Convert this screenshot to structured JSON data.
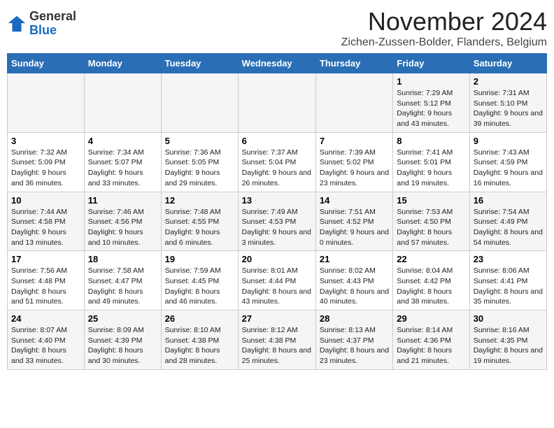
{
  "logo": {
    "general": "General",
    "blue": "Blue"
  },
  "title": "November 2024",
  "location": "Zichen-Zussen-Bolder, Flanders, Belgium",
  "weekdays": [
    "Sunday",
    "Monday",
    "Tuesday",
    "Wednesday",
    "Thursday",
    "Friday",
    "Saturday"
  ],
  "weeks": [
    [
      {
        "day": "",
        "info": ""
      },
      {
        "day": "",
        "info": ""
      },
      {
        "day": "",
        "info": ""
      },
      {
        "day": "",
        "info": ""
      },
      {
        "day": "",
        "info": ""
      },
      {
        "day": "1",
        "info": "Sunrise: 7:29 AM\nSunset: 5:12 PM\nDaylight: 9 hours and 43 minutes."
      },
      {
        "day": "2",
        "info": "Sunrise: 7:31 AM\nSunset: 5:10 PM\nDaylight: 9 hours and 39 minutes."
      }
    ],
    [
      {
        "day": "3",
        "info": "Sunrise: 7:32 AM\nSunset: 5:09 PM\nDaylight: 9 hours and 36 minutes."
      },
      {
        "day": "4",
        "info": "Sunrise: 7:34 AM\nSunset: 5:07 PM\nDaylight: 9 hours and 33 minutes."
      },
      {
        "day": "5",
        "info": "Sunrise: 7:36 AM\nSunset: 5:05 PM\nDaylight: 9 hours and 29 minutes."
      },
      {
        "day": "6",
        "info": "Sunrise: 7:37 AM\nSunset: 5:04 PM\nDaylight: 9 hours and 26 minutes."
      },
      {
        "day": "7",
        "info": "Sunrise: 7:39 AM\nSunset: 5:02 PM\nDaylight: 9 hours and 23 minutes."
      },
      {
        "day": "8",
        "info": "Sunrise: 7:41 AM\nSunset: 5:01 PM\nDaylight: 9 hours and 19 minutes."
      },
      {
        "day": "9",
        "info": "Sunrise: 7:43 AM\nSunset: 4:59 PM\nDaylight: 9 hours and 16 minutes."
      }
    ],
    [
      {
        "day": "10",
        "info": "Sunrise: 7:44 AM\nSunset: 4:58 PM\nDaylight: 9 hours and 13 minutes."
      },
      {
        "day": "11",
        "info": "Sunrise: 7:46 AM\nSunset: 4:56 PM\nDaylight: 9 hours and 10 minutes."
      },
      {
        "day": "12",
        "info": "Sunrise: 7:48 AM\nSunset: 4:55 PM\nDaylight: 9 hours and 6 minutes."
      },
      {
        "day": "13",
        "info": "Sunrise: 7:49 AM\nSunset: 4:53 PM\nDaylight: 9 hours and 3 minutes."
      },
      {
        "day": "14",
        "info": "Sunrise: 7:51 AM\nSunset: 4:52 PM\nDaylight: 9 hours and 0 minutes."
      },
      {
        "day": "15",
        "info": "Sunrise: 7:53 AM\nSunset: 4:50 PM\nDaylight: 8 hours and 57 minutes."
      },
      {
        "day": "16",
        "info": "Sunrise: 7:54 AM\nSunset: 4:49 PM\nDaylight: 8 hours and 54 minutes."
      }
    ],
    [
      {
        "day": "17",
        "info": "Sunrise: 7:56 AM\nSunset: 4:48 PM\nDaylight: 8 hours and 51 minutes."
      },
      {
        "day": "18",
        "info": "Sunrise: 7:58 AM\nSunset: 4:47 PM\nDaylight: 8 hours and 49 minutes."
      },
      {
        "day": "19",
        "info": "Sunrise: 7:59 AM\nSunset: 4:45 PM\nDaylight: 8 hours and 46 minutes."
      },
      {
        "day": "20",
        "info": "Sunrise: 8:01 AM\nSunset: 4:44 PM\nDaylight: 8 hours and 43 minutes."
      },
      {
        "day": "21",
        "info": "Sunrise: 8:02 AM\nSunset: 4:43 PM\nDaylight: 8 hours and 40 minutes."
      },
      {
        "day": "22",
        "info": "Sunrise: 8:04 AM\nSunset: 4:42 PM\nDaylight: 8 hours and 38 minutes."
      },
      {
        "day": "23",
        "info": "Sunrise: 8:06 AM\nSunset: 4:41 PM\nDaylight: 8 hours and 35 minutes."
      }
    ],
    [
      {
        "day": "24",
        "info": "Sunrise: 8:07 AM\nSunset: 4:40 PM\nDaylight: 8 hours and 33 minutes."
      },
      {
        "day": "25",
        "info": "Sunrise: 8:09 AM\nSunset: 4:39 PM\nDaylight: 8 hours and 30 minutes."
      },
      {
        "day": "26",
        "info": "Sunrise: 8:10 AM\nSunset: 4:38 PM\nDaylight: 8 hours and 28 minutes."
      },
      {
        "day": "27",
        "info": "Sunrise: 8:12 AM\nSunset: 4:38 PM\nDaylight: 8 hours and 25 minutes."
      },
      {
        "day": "28",
        "info": "Sunrise: 8:13 AM\nSunset: 4:37 PM\nDaylight: 8 hours and 23 minutes."
      },
      {
        "day": "29",
        "info": "Sunrise: 8:14 AM\nSunset: 4:36 PM\nDaylight: 8 hours and 21 minutes."
      },
      {
        "day": "30",
        "info": "Sunrise: 8:16 AM\nSunset: 4:35 PM\nDaylight: 8 hours and 19 minutes."
      }
    ]
  ]
}
